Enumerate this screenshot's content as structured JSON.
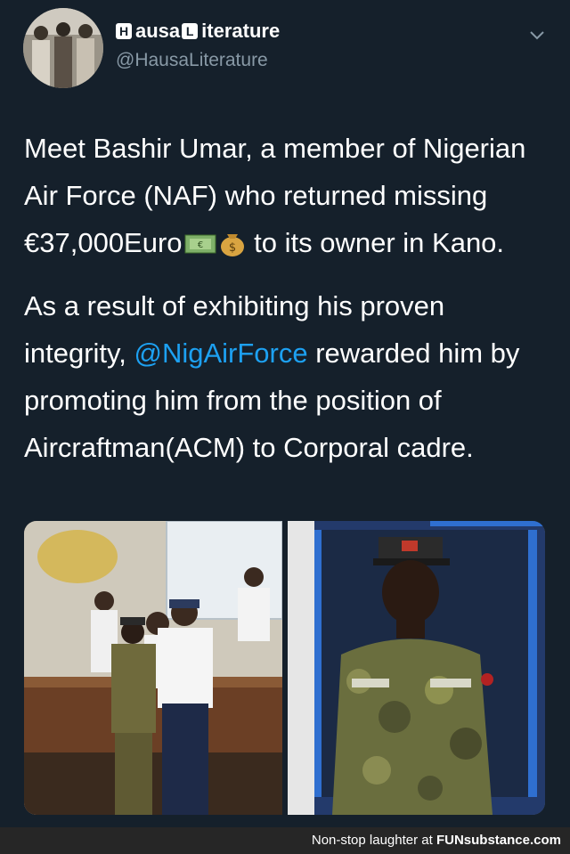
{
  "profile": {
    "display_name_letters": [
      "H",
      "L"
    ],
    "display_name_parts": [
      "ausa ",
      "iterature"
    ],
    "handle": "@HausaLiterature",
    "avatar_icon": "group-photo-avatar"
  },
  "menu_icon": "chevron-down-icon",
  "tweet": {
    "p1_text": "Meet Bashir Umar, a member of Nigerian Air Force (NAF) who returned missing €37,000Euro",
    "p1_emojis": [
      "money-bills-emoji",
      "money-bag-emoji"
    ],
    "p1_end": " to its owner in Kano.",
    "p2_before": "As a result of exhibiting his proven integrity, ",
    "p2_mention": "@NigAirForce",
    "p2_after": " rewarded him by promoting him from the position of Aircraftman(ACM) to Corporal cadre."
  },
  "media": {
    "left_photo": "ceremony-photo",
    "right_photo": "soldier-portrait-photo"
  },
  "footer": {
    "text": "Non-stop laughter at ",
    "brand": "FUNsubstance.com"
  },
  "colors": {
    "background": "#15202b",
    "link": "#1da1f2",
    "secondary_text": "#8899a6"
  }
}
